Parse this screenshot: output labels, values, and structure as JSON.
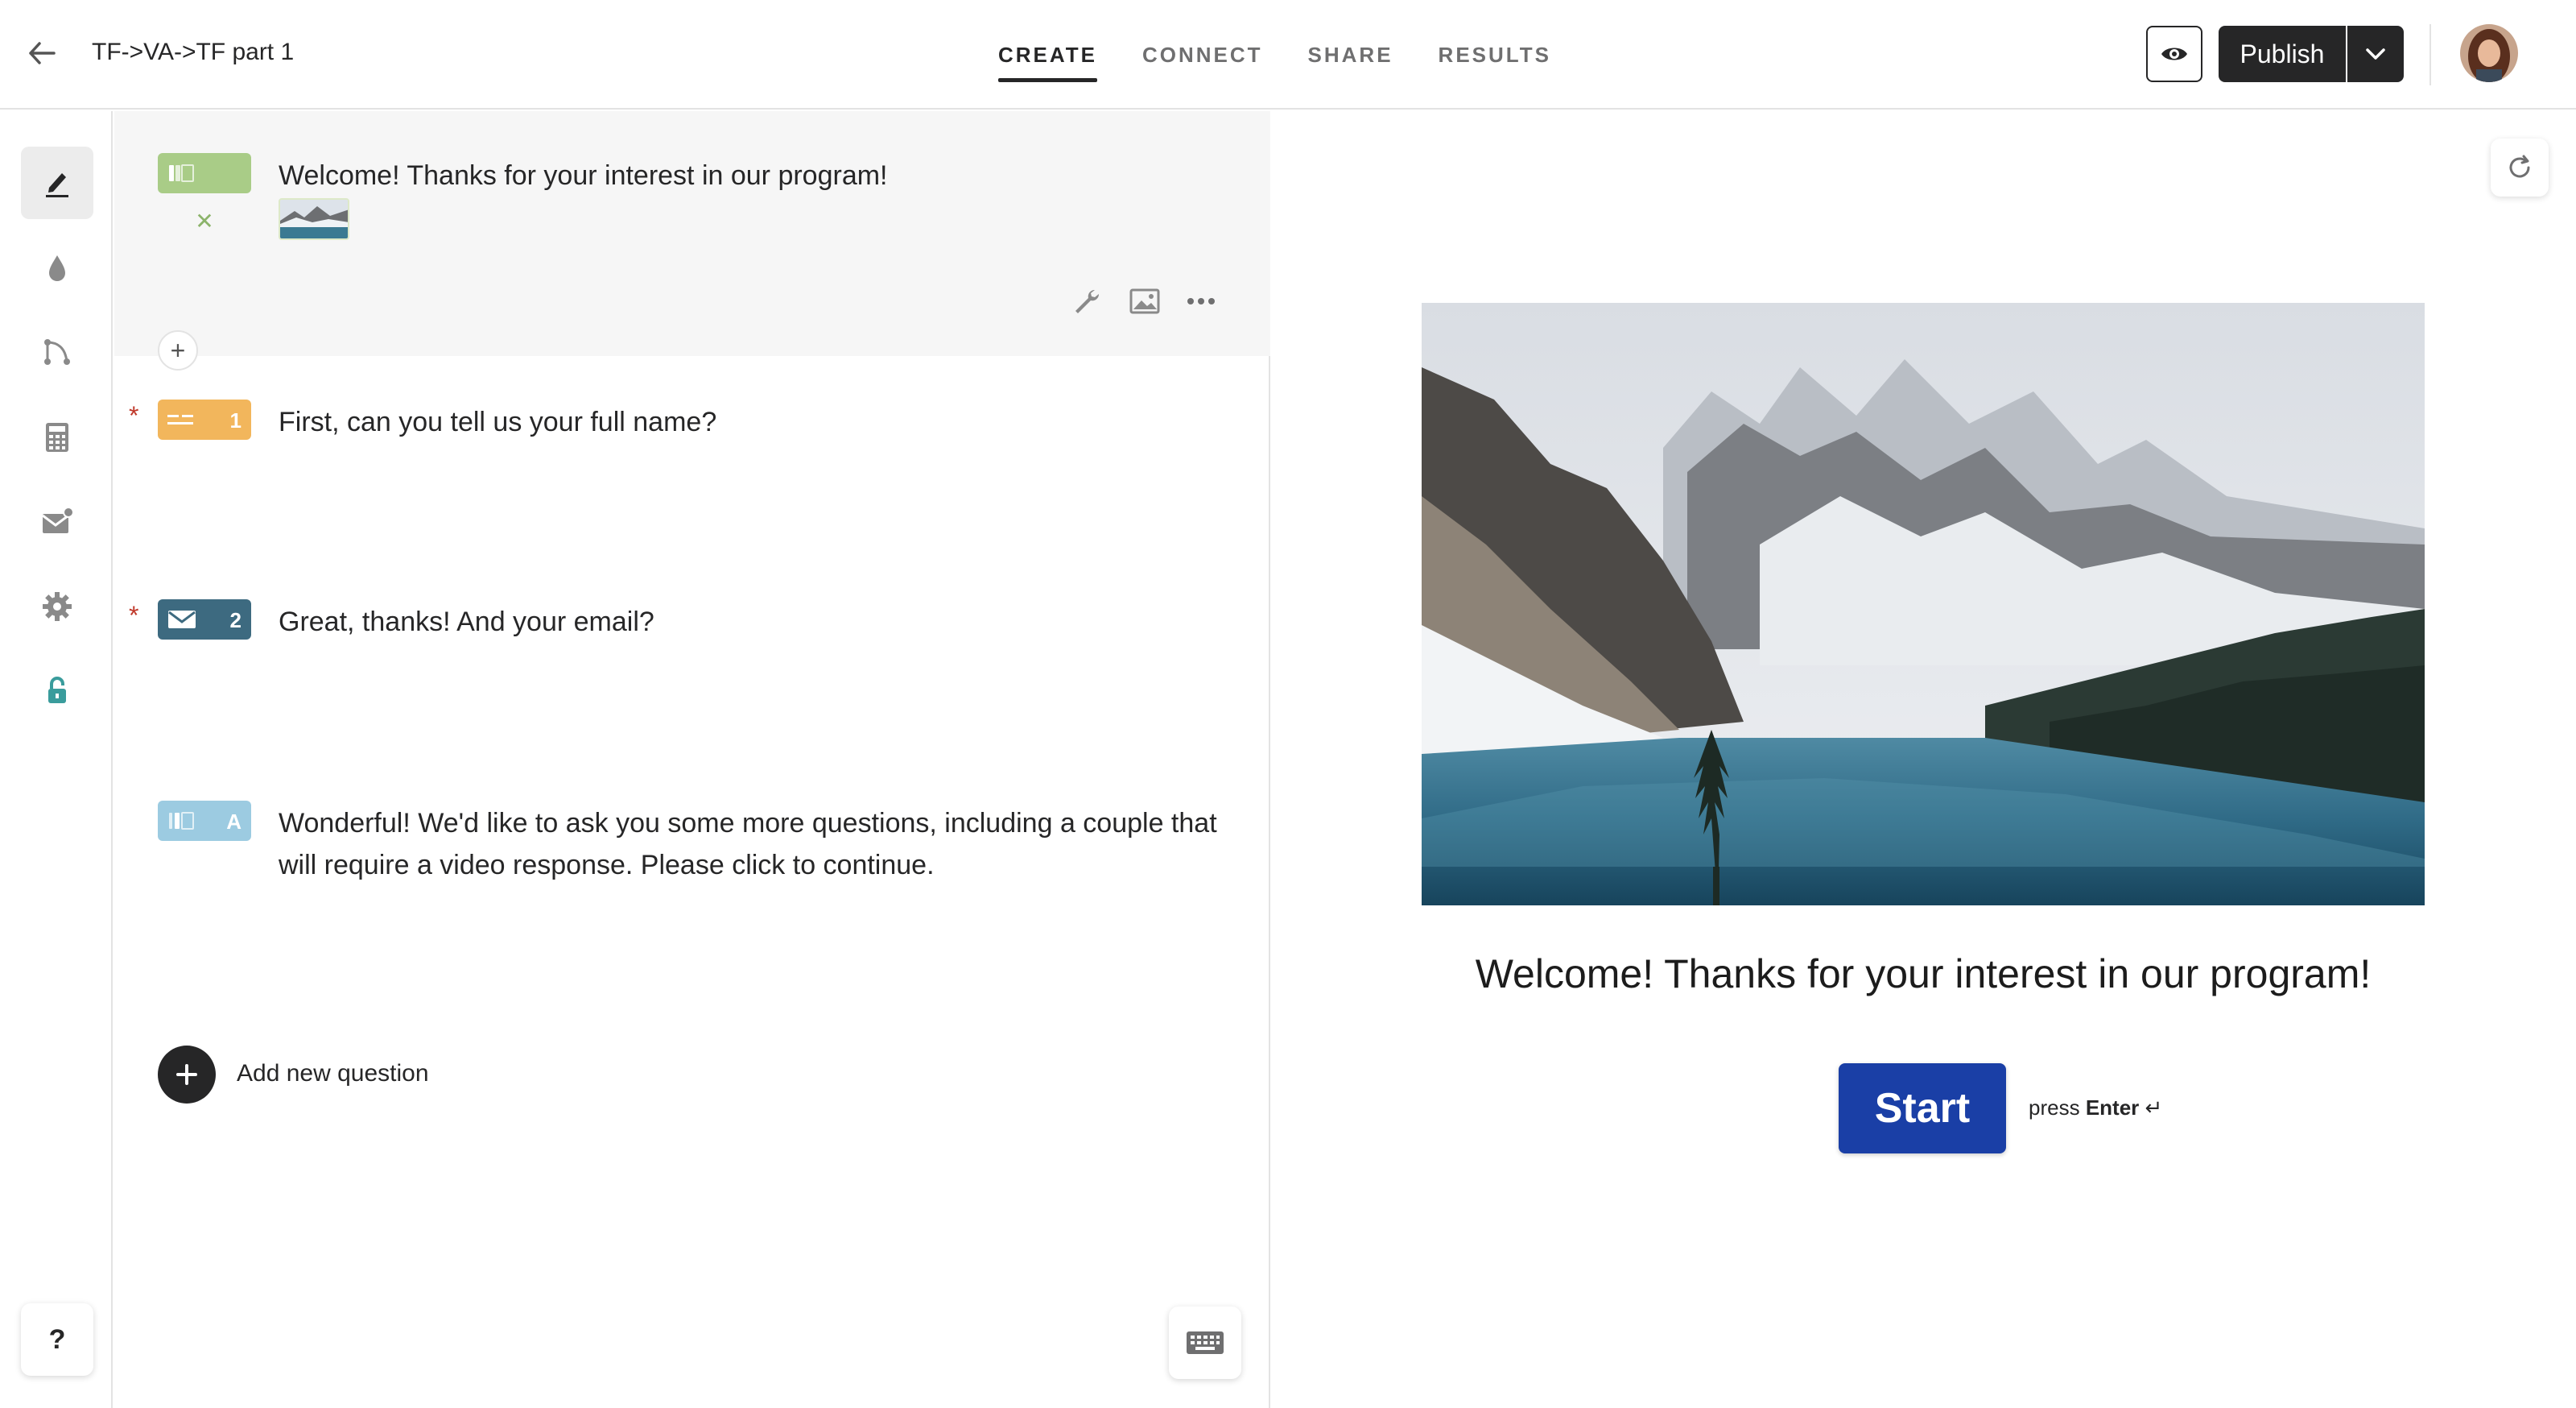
{
  "header": {
    "title": "TF->VA->TF part 1",
    "tabs": [
      {
        "label": "CREATE",
        "active": true
      },
      {
        "label": "CONNECT",
        "active": false
      },
      {
        "label": "SHARE",
        "active": false
      },
      {
        "label": "RESULTS",
        "active": false
      }
    ],
    "publish_label": "Publish"
  },
  "sidebar": {
    "items": [
      {
        "icon": "pencil-icon",
        "active": true
      },
      {
        "icon": "droplet-icon",
        "active": false
      },
      {
        "icon": "logic-branch-icon",
        "active": false
      },
      {
        "icon": "calculator-icon",
        "active": false
      },
      {
        "icon": "mail-notification-icon",
        "active": false
      },
      {
        "icon": "gear-icon",
        "active": false
      },
      {
        "icon": "lock-icon",
        "active": false
      }
    ],
    "help_label": "?"
  },
  "editor": {
    "welcome": {
      "text": "Welcome! Thanks for your interest in our program!",
      "badge_color": "#a9cc87"
    },
    "questions": [
      {
        "number": "1",
        "text": "First, can you tell us your full name?",
        "required": true,
        "badge_color": "#f2b65c",
        "icon": "short-text-icon"
      },
      {
        "number": "2",
        "text": "Great, thanks! And your email?",
        "required": true,
        "badge_color": "#3d6a80",
        "icon": "mail-icon"
      },
      {
        "number": "A",
        "text": "Wonderful! We'd like to ask you some more questions, including a couple that will require a video response. Please click to continue.",
        "required": false,
        "badge_color": "#9ccbe1",
        "icon": "statement-icon"
      }
    ],
    "required_mark": "*",
    "add_question_label": "Add new question"
  },
  "preview": {
    "title": "Welcome! Thanks for your interest in our program!",
    "start_label": "Start",
    "press_label": "press",
    "enter_label": "Enter",
    "enter_symbol": "↵",
    "button_color": "#1a3fa6"
  }
}
